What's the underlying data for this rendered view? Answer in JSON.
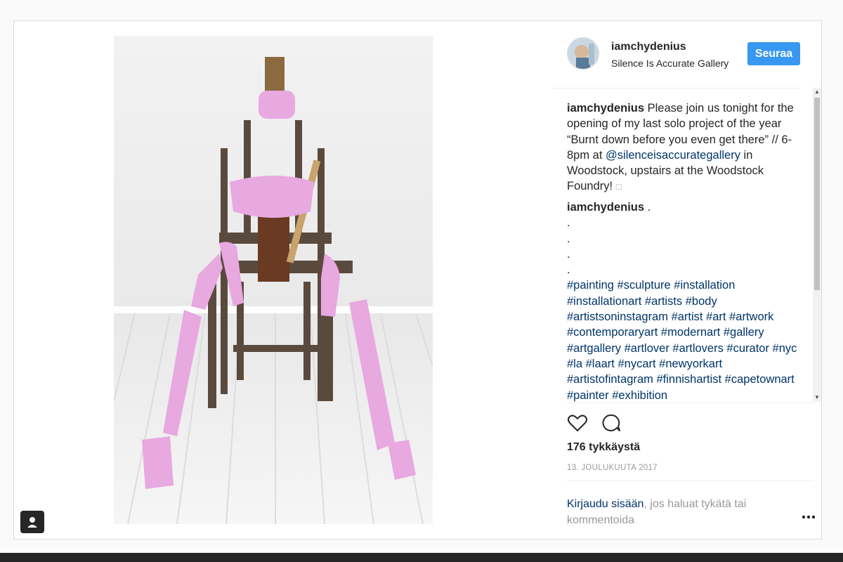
{
  "post": {
    "username": "iamchydenius",
    "location": "Silence Is Accurate Gallery",
    "follow_label": "Seuraa"
  },
  "caption": {
    "username": "iamchydenius",
    "text_1": "Please join us tonight for the opening of my last solo project of the year “Burnt down before you even get there” // 6-8pm at ",
    "mention": "@silenceisaccurategallery",
    "text_2": " in Woodstock, upstairs at the Woodstock Foundry! ",
    "emoji_box": "□"
  },
  "comment2": {
    "username": "iamchydenius",
    "text": ".",
    "dots": [
      ".",
      ".",
      ".",
      "."
    ],
    "hashtags": "#painting #sculpture #installation #installationart #artists #body #artistsoninstagram #artist #art #artwork #contemporaryart #modernart #gallery #artgallery #artlover #artlovers #curator #nyc #la #laart #nycart #newyorkart #artistofintagram #finnishartist #capetownart #painter #exhibition"
  },
  "stats": {
    "likes": "176 tykkäystä",
    "date": "13. JOULUKUUTA 2017"
  },
  "login_prompt": {
    "link": "Kirjaudu sisään",
    "text": ", jos haluat tykätä tai kommentoida"
  },
  "icons": {
    "like": "heart-icon",
    "comment": "speech-bubble-icon",
    "more": "more-options-icon",
    "user_tag": "person-tag-icon"
  },
  "colors": {
    "accent": "#3897f0",
    "link": "#003569",
    "muted": "#999999"
  }
}
